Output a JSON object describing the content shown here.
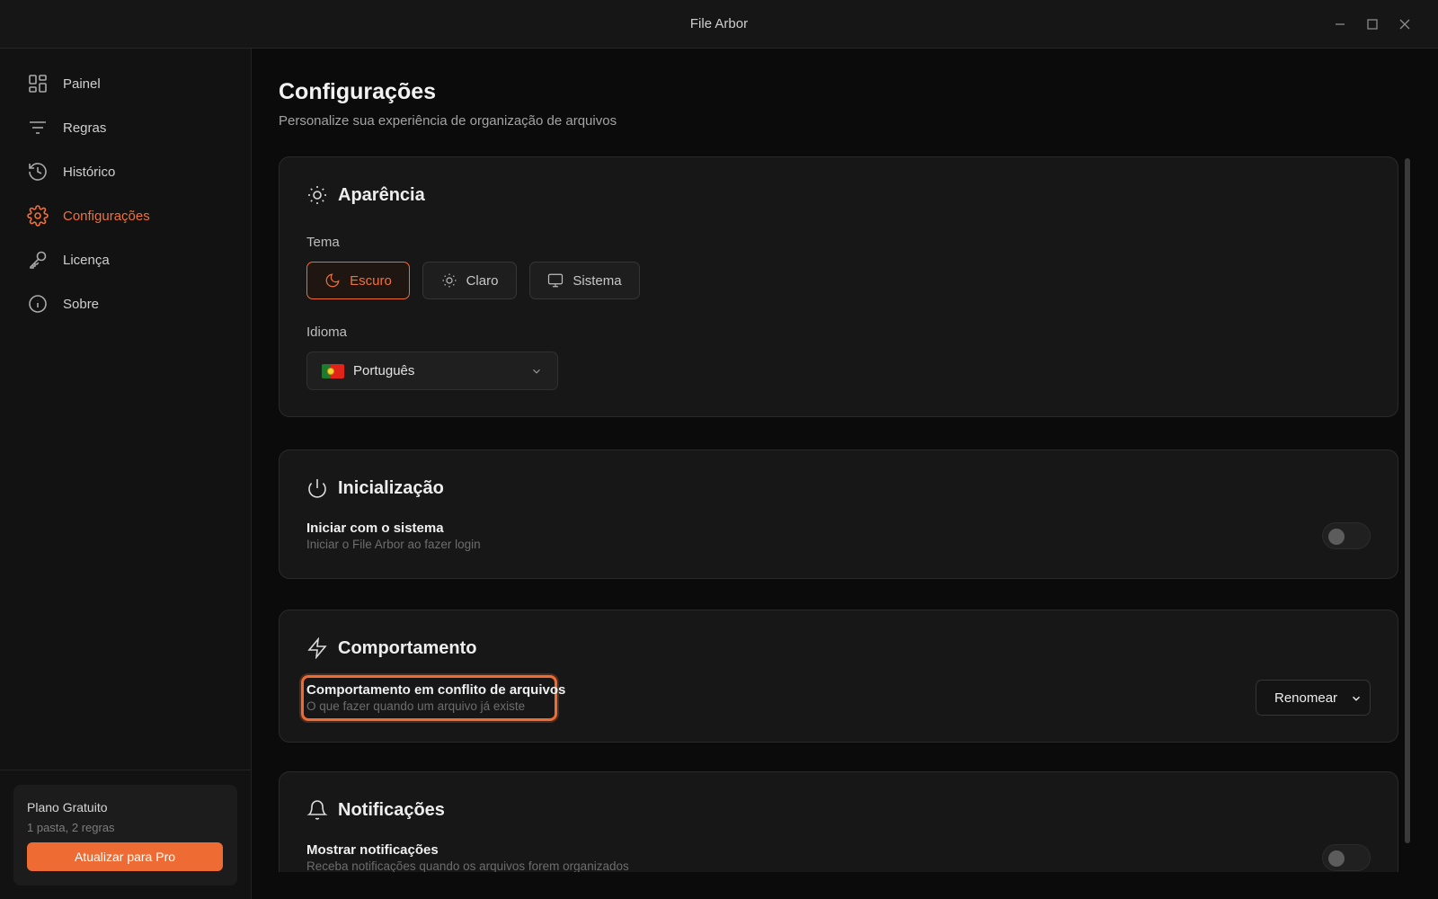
{
  "window": {
    "title": "File Arbor"
  },
  "sidebar": {
    "items": [
      {
        "label": "Painel",
        "icon": "dashboard-grid-icon"
      },
      {
        "label": "Regras",
        "icon": "filter-lines-icon"
      },
      {
        "label": "Histórico",
        "icon": "history-clock-icon"
      },
      {
        "label": "Configurações",
        "icon": "gear-icon",
        "active": true
      },
      {
        "label": "Licença",
        "icon": "key-icon"
      },
      {
        "label": "Sobre",
        "icon": "info-circle-icon"
      }
    ],
    "plan": {
      "title": "Plano Gratuito",
      "subtitle": "1 pasta, 2 regras",
      "upgrade_label": "Atualizar para Pro"
    }
  },
  "main": {
    "title": "Configurações",
    "subtitle": "Personalize sua experiência de organização de arquivos",
    "appearance": {
      "title": "Aparência",
      "theme_label": "Tema",
      "themes": [
        {
          "label": "Escuro",
          "selected": true
        },
        {
          "label": "Claro",
          "selected": false
        },
        {
          "label": "Sistema",
          "selected": false
        }
      ],
      "language_label": "Idioma",
      "language_value": "Português"
    },
    "startup": {
      "title": "Inicialização",
      "option_title": "Iniciar com o sistema",
      "option_desc": "Iniciar o File Arbor ao fazer login",
      "enabled": false
    },
    "behavior": {
      "title": "Comportamento",
      "option_title": "Comportamento em conflito de arquivos",
      "option_desc": "O que fazer quando um arquivo já existe",
      "selected_value": "Renomear"
    },
    "notifications": {
      "title": "Notificações",
      "option_title": "Mostrar notificações",
      "option_desc": "Receba notificações quando os arquivos forem organizados",
      "enabled": false
    }
  },
  "colors": {
    "accent": "#ee6c34",
    "background": "#0b0b0b",
    "card": "#171717"
  }
}
